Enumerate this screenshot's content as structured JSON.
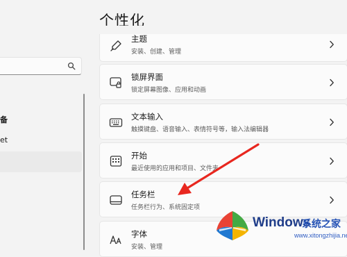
{
  "header": {
    "title": "个性化"
  },
  "sidebar": {
    "search": {
      "placeholder": "",
      "icon": "search-icon"
    },
    "items": [
      {
        "label": "备",
        "selected": false
      },
      {
        "label": "et",
        "selected": false
      },
      {
        "label": "",
        "selected": true
      }
    ]
  },
  "settings": {
    "items": [
      {
        "title": "主题",
        "description": "安装、创建、管理",
        "icon": "brush-icon"
      },
      {
        "title": "锁屏界面",
        "description": "锁定屏幕图像、应用和动画",
        "icon": "lock-screen-icon"
      },
      {
        "title": "文本输入",
        "description": "触摸键盘、语音输入、表情符号等，输入法编辑器",
        "icon": "keyboard-icon"
      },
      {
        "title": "开始",
        "description": "最近使用的应用和项目、文件夹",
        "icon": "start-menu-icon"
      },
      {
        "title": "任务栏",
        "description": "任务栏行为、系统固定项",
        "icon": "taskbar-icon"
      },
      {
        "title": "字体",
        "description": "安装、管理",
        "icon": "font-icon"
      }
    ]
  },
  "annotation": {
    "arrow_color": "#e8271f",
    "target": "任务栏"
  },
  "watermark": {
    "brand": "Windows",
    "text": "系统之家",
    "url": "www.xitongzhijia.net",
    "logo_colors": [
      "#e8392a",
      "#3aa53a",
      "#1f78d1",
      "#f4b400"
    ]
  }
}
